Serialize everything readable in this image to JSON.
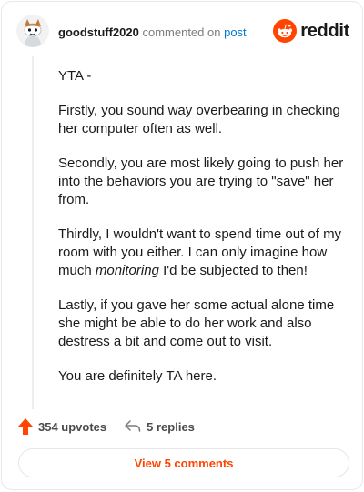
{
  "header": {
    "username": "goodstuff2020",
    "commented_on": "commented on",
    "post_link": "post",
    "brand": "reddit",
    "avatar_icon": "snoo-avatar-icon",
    "brand_icon": "reddit-logo-icon"
  },
  "comment": {
    "paragraphs": [
      "YTA -",
      "Firstly, you sound way overbearing in checking her computer often as well.",
      "Secondly, you are most likely going to push her into the behaviors you are trying to \"save\" her from.",
      {
        "before": "Thirdly, I wouldn't want to spend time out of my room with you either. I can only imagine how much ",
        "emphasis": "monitoring",
        "after": " I'd be subjected to then!"
      },
      "Lastly, if you gave her some actual alone time she might be able to do her work and also destress a bit and come out to visit.",
      "You are definitely TA here."
    ]
  },
  "actions": {
    "upvotes_label": "354 upvotes",
    "replies_label": "5 replies",
    "upvote_icon": "upvote-arrow-icon",
    "reply_icon": "reply-arrow-icon"
  },
  "footer": {
    "view_comments_label": "View 5 comments"
  },
  "colors": {
    "accent": "#ff4500",
    "link": "#0079d3",
    "muted": "#7c7c7c"
  }
}
